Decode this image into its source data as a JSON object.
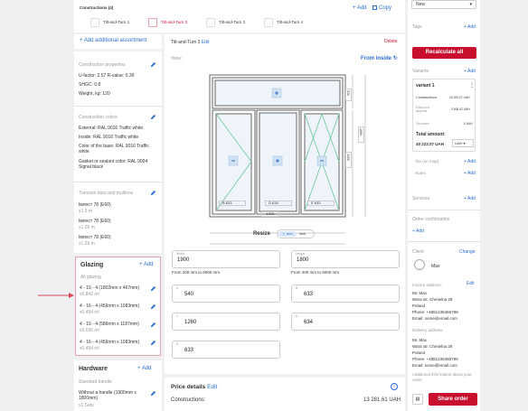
{
  "constructions": {
    "title": "Constructions (4)",
    "add_label": "+ Add",
    "copy_label": "Copy",
    "tabs": [
      {
        "label": "Tilt-and-Turn 1"
      },
      {
        "label": "Tilt-and-Turn 3"
      },
      {
        "label": "Tilt-and-Turn 3"
      },
      {
        "label": "Tilt-and-Turn 4"
      }
    ]
  },
  "assortment": {
    "add_label": "+ Add additional assortment"
  },
  "properties": {
    "title": "Construction properties",
    "uf": "U-factor: 2.57  R-value: 0.39",
    "shgc": "SHGC: 0.8",
    "weight": "Weight, kg: 120"
  },
  "colors": {
    "title": "Construction colors",
    "external": "External: RAL 9016 Traffic white",
    "inside": "Inside: RAL 9016 Traffic white",
    "base": "Color of the base: RAL 9016 Traffic white",
    "gasket": "Gasket or sealant color: RAL 9004 Signal black"
  },
  "transoms": {
    "title": "Transom bars and mullions",
    "items": [
      {
        "name": "Імпост 78 (E60)",
        "qty": "x1.9 m"
      },
      {
        "name": "Імпост 78 (E60)",
        "qty": "x1.26 m"
      },
      {
        "name": "Імпост 78 (E60)",
        "qty": "x1.26 m"
      }
    ]
  },
  "glazing": {
    "title": "Glazing",
    "add_label": "+ Add",
    "subtitle": "All glazing",
    "items": [
      {
        "name": "4 - 16 - 4 (1802mm x 467mm)",
        "qty": "x0.842 m²"
      },
      {
        "name": "4 - 16 - 4 (456mm x 1083mm)",
        "qty": "x0.494 m²"
      },
      {
        "name": "4 - 16 - 4 (586mm x 1187mm)",
        "qty": "x0.696 m²"
      },
      {
        "name": "4 - 16 - 4 (456mm x 1083mm)",
        "qty": "x0.494 m²"
      }
    ]
  },
  "hardware": {
    "title": "Hardware",
    "add_label": "+ Add",
    "subtitle": "Standard handle",
    "item_name": "Without a handle (1900mm x 1800mm)",
    "item_qty": "x1 Sets"
  },
  "editor": {
    "title": "Tilt-and-Turn 3",
    "edit_label": "Edit",
    "delete_label": "Delete",
    "view_label": "View:",
    "view_mode": "From inside",
    "dim_width_total": "1900",
    "dim_height_total": "1800",
    "dim_top": "540",
    "dim_right": "1260",
    "dim_633": "633",
    "dim_634": "634",
    "seg_a": "A",
    "seg_b": "B",
    "seg_c": "C",
    "seg_d": "D",
    "seg_e": "E",
    "resize_label": "Resize",
    "unit_mm": "mm",
    "unit_inch": "inch"
  },
  "fields": {
    "width_label": "Width",
    "width_value": "1900",
    "width_hint": "From 200 mm to 6000 mm",
    "height_label": "Height",
    "height_value": "1800",
    "height_hint": "From 200 mm to 6000 mm",
    "a_value": "540",
    "b_value": "633",
    "c_value": "1260",
    "d_value": "634",
    "e_value": "633"
  },
  "price": {
    "title": "Price details",
    "edit_label": "Edit",
    "row_label": "Constructions:",
    "row_value": "13 281.61 UAH"
  },
  "right": {
    "status": "New",
    "tags_label": "Tags",
    "tags_add": "+ Add",
    "recalc_label": "Recalculate all",
    "variants_label": "Variants",
    "variants_add": "+ Add",
    "variant_name": "variant 1",
    "v_constructions_label": "Constructions",
    "v_constructions_value": "40 222.07 UAH",
    "v_discount_label": "Discount applied",
    "v_discount_value": "3 508.42 UAH",
    "v_services_label": "Services",
    "v_services_value": "0 UAH",
    "v_total_label": "Total amount:",
    "v_total_value": "40 222.07 UAH",
    "v_currency": "UAH",
    "tax_label": "Tax (on map)",
    "tax_add": "+ Add",
    "notes_label": "Notes",
    "notes_add": "+ Add",
    "services_label": "Services",
    "services_add": "+ Add",
    "confirmation_label": "Order confirmation",
    "confirmation_add": "+ Add",
    "client_label": "Client",
    "client_change": "Change",
    "client_name": "Max",
    "invoice_label": "Invoice address:",
    "invoice_edit": "Edit",
    "invoice_lines": [
      "Mr. Max",
      "Wara str. Chmielna 29",
      "Poland",
      "Phone: +4881235456789",
      "Email: some@email.com"
    ],
    "delivery_label": "Delivery address",
    "delivery_lines": [
      "Mr. Max",
      "Wara str. Chmielna 29",
      "Poland",
      "Phone: +4881235456789",
      "Email: some@email.com"
    ],
    "additional_label": "Additional information about your order",
    "share_label": "Share order"
  },
  "colors_ui": {
    "accent": "#2b6cd4",
    "brand": "#c8102e",
    "highlight": "#e8a3ad"
  }
}
